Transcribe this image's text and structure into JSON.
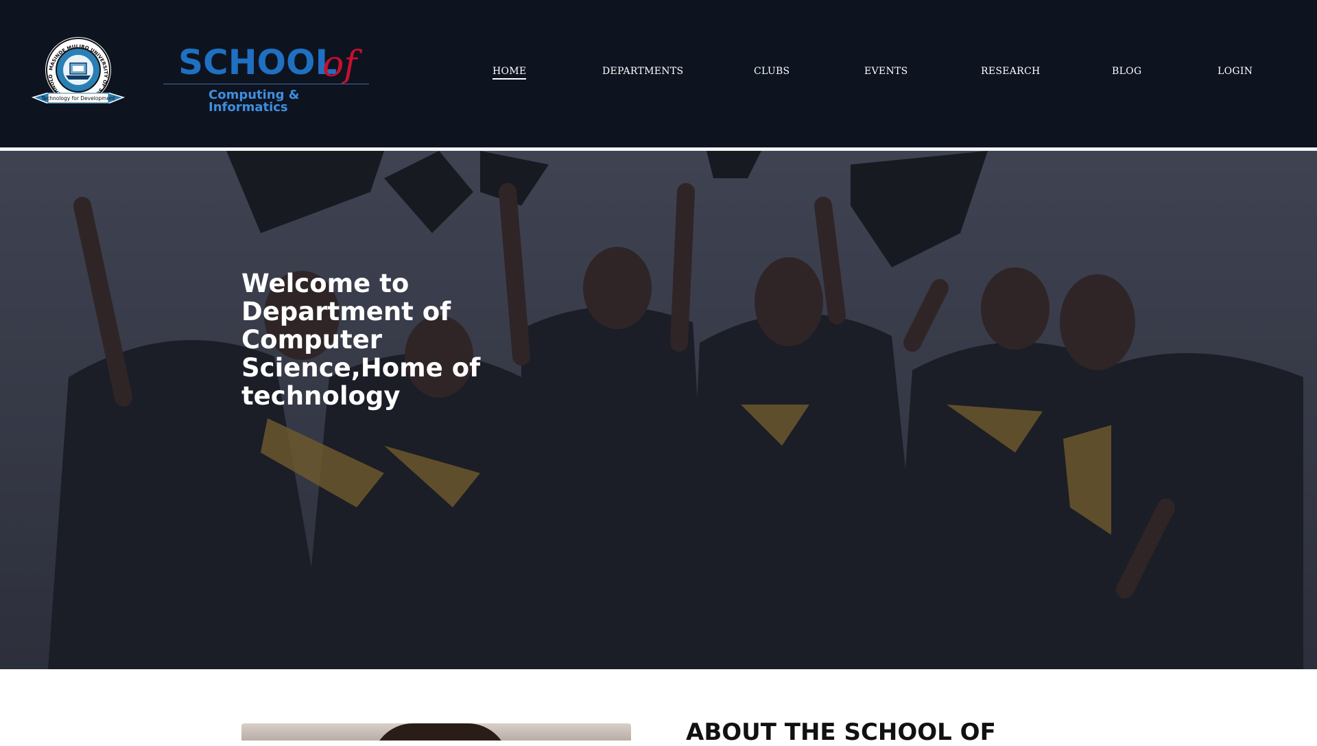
{
  "header": {
    "seal": {
      "ring_text": "MASINDE MULIRO UNIVERSITY OF SCIENCE AND TECHNOLOGY",
      "motto": "Technology for Development"
    },
    "logo": {
      "school": "SCHOOL",
      "of": "of",
      "subtitle": "Computing & Informatics"
    },
    "nav": [
      {
        "label": "HOME",
        "active": true
      },
      {
        "label": "DEPARTMENTS"
      },
      {
        "label": "CLUBS"
      },
      {
        "label": "EVENTS"
      },
      {
        "label": "RESEARCH"
      },
      {
        "label": "BLOG"
      },
      {
        "label": "LOGIN"
      }
    ]
  },
  "hero": {
    "title": "Welcome to Department of Computer Science,Home of technology"
  },
  "about": {
    "heading": "ABOUT THE SCHOOL OF"
  },
  "colors": {
    "header_bg": "#0e1320",
    "logo_blue": "#1f70c1",
    "logo_red": "#c8102e",
    "hero_overlay": "#1c202c"
  }
}
